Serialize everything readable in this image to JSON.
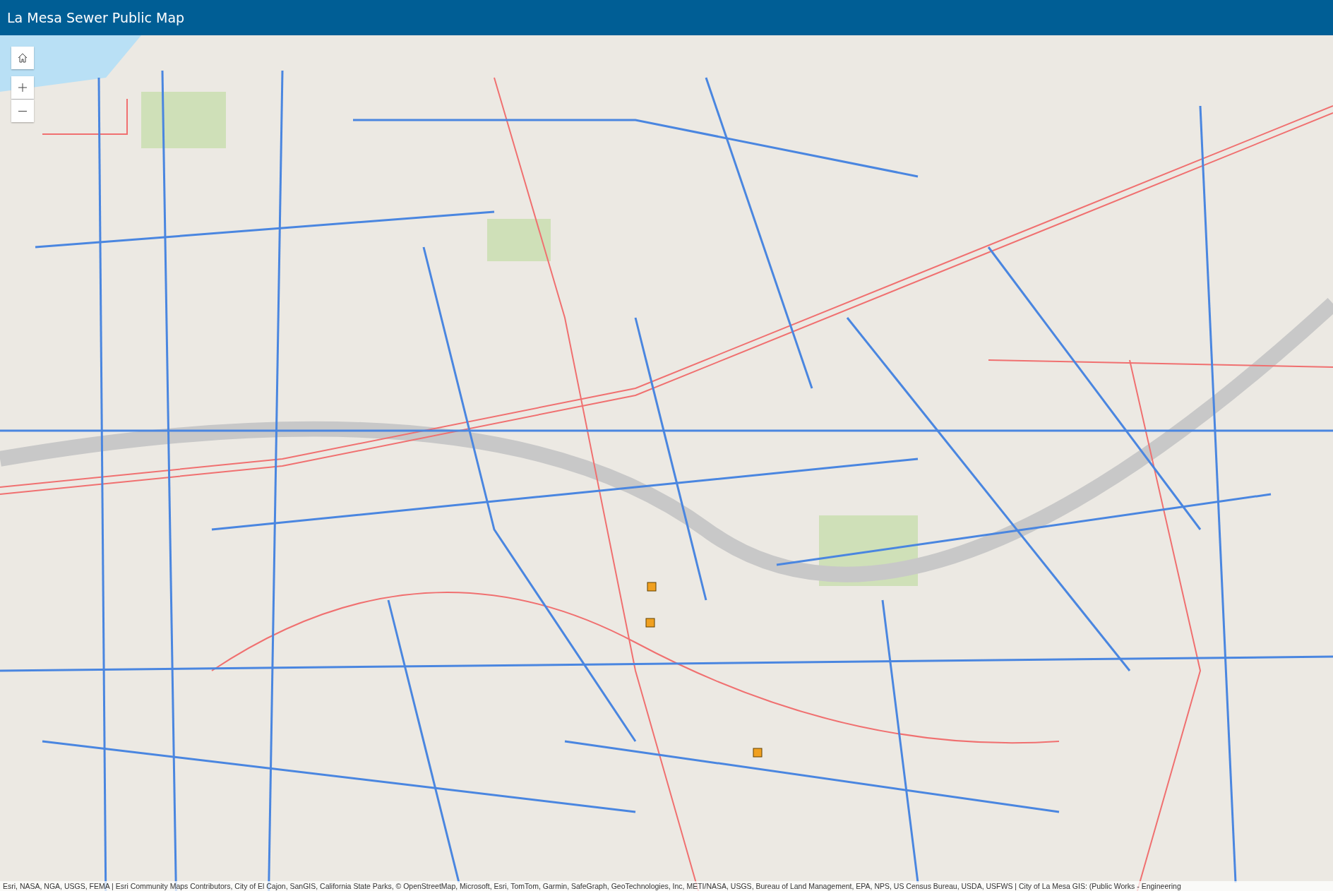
{
  "header": {
    "title": "La Mesa Sewer Public Map"
  },
  "map": {
    "attribution": "Esri, NASA, NGA, USGS, FEMA | Esri Community Maps Contributors, City of El Cajon, SanGIS, California State Parks, © OpenStreetMap, Microsoft, Esri, TomTom, Garmin, SafeGraph, GeoTechnologies, Inc, METI/NASA, USGS, Bureau of Land Management, EPA, NPS, US Census Bureau, USDA, USFWS | City of La Mesa GIS: (Public Works - Engineering"
  }
}
